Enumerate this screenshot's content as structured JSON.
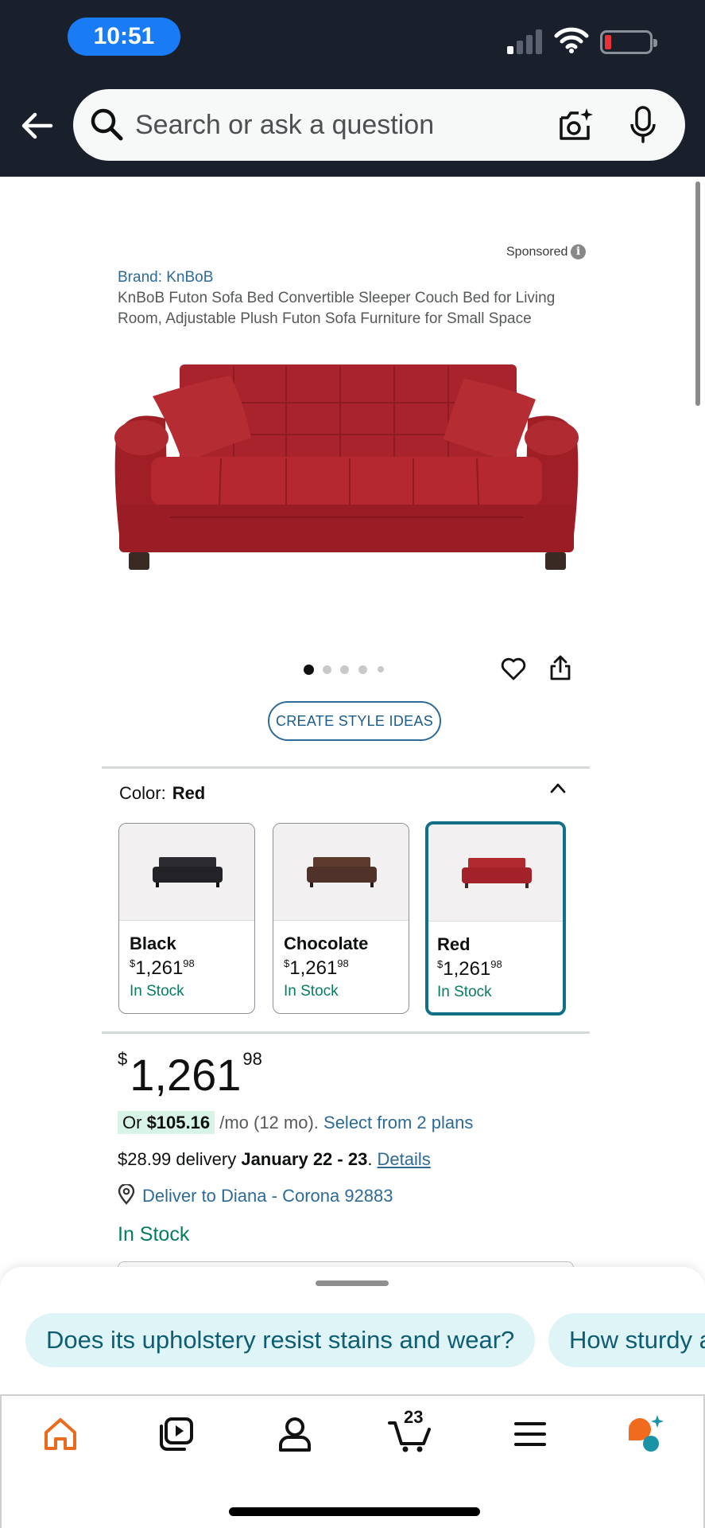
{
  "status_bar": {
    "time": "10:51"
  },
  "search": {
    "placeholder": "Search or ask a question"
  },
  "product": {
    "sponsored": "Sponsored",
    "brand": "Brand: KnBoB",
    "title": "KnBoB Futon Sofa Bed Convertible Sleeper Couch Bed for Living Room, Adjustable Plush Futon Sofa Furniture for Small Space",
    "image_count": 5,
    "active_image_index": 0,
    "style_button": "CREATE STYLE IDEAS",
    "color_label": "Color:",
    "selected_color": "Red",
    "variants": [
      {
        "name": "Black",
        "price_symbol": "$",
        "price_whole": "1,261",
        "price_cents": "98",
        "stock": "In Stock",
        "color": "#2b2b30"
      },
      {
        "name": "Chocolate",
        "price_symbol": "$",
        "price_whole": "1,261",
        "price_cents": "98",
        "stock": "In Stock",
        "color": "#5e3a2c"
      },
      {
        "name": "Red",
        "price_symbol": "$",
        "price_whole": "1,261",
        "price_cents": "98",
        "stock": "In Stock",
        "color": "#b02a30"
      }
    ],
    "price": {
      "symbol": "$",
      "whole": "1,261",
      "cents": "98"
    },
    "monthly": {
      "prefix": "Or ",
      "amount": "$105.16",
      "suffix": " /mo (12 mo). ",
      "link": "Select from 2 plans"
    },
    "delivery": {
      "prefix": "$28.99 delivery ",
      "dates": "January 22 - 23",
      "dot": ". ",
      "link": "Details"
    },
    "deliver_to": "Deliver to Diana - Corona 92883",
    "stock_status": "In Stock"
  },
  "suggestions": [
    "Does its upholstery resist stains and wear?",
    "How sturdy are the legs?"
  ],
  "nav": {
    "cart_count": "23",
    "active": "home",
    "accent_color": "#e96b1c"
  }
}
